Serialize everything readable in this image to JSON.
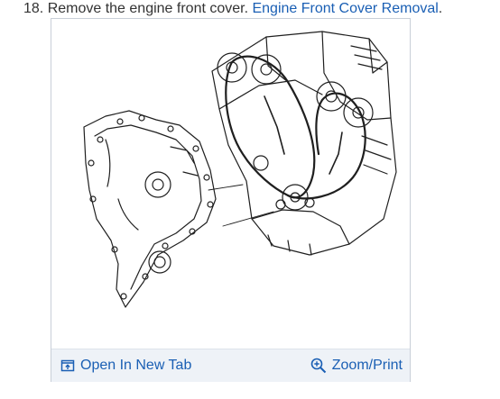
{
  "step": {
    "text": "18. Remove the engine front cover. ",
    "link_label": "Engine Front Cover Removal",
    "suffix": "."
  },
  "figure": {
    "open_tab_label": "Open In New Tab",
    "zoom_label": "Zoom/Print",
    "open_tab_icon": "open-in-new-tab-icon",
    "zoom_icon": "magnifier-plus-icon",
    "accent_color": "#1a5fb4",
    "footer_bg": "#eef2f7"
  }
}
